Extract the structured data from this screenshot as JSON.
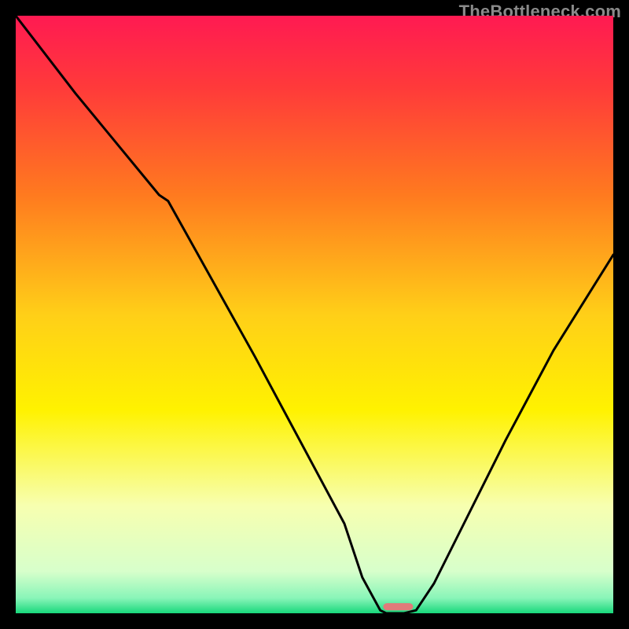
{
  "watermark": "TheBottleneck.com",
  "chart_data": {
    "type": "line",
    "title": "",
    "xlabel": "",
    "ylabel": "",
    "xlim": [
      0,
      100
    ],
    "ylim": [
      0,
      100
    ],
    "grid": false,
    "legend": null,
    "background_gradient": {
      "stops": [
        {
          "t": 0.0,
          "color": "#ff1a52"
        },
        {
          "t": 0.12,
          "color": "#ff3a3a"
        },
        {
          "t": 0.3,
          "color": "#ff7a1f"
        },
        {
          "t": 0.5,
          "color": "#ffcf18"
        },
        {
          "t": 0.66,
          "color": "#fff200"
        },
        {
          "t": 0.82,
          "color": "#f7ffb0"
        },
        {
          "t": 0.93,
          "color": "#d7ffcb"
        },
        {
          "t": 0.975,
          "color": "#88f5b8"
        },
        {
          "t": 1.0,
          "color": "#17d77b"
        }
      ]
    },
    "series": [
      {
        "name": "bottleneck-curve",
        "color": "#000000",
        "x": [
          0,
          10,
          24,
          25.5,
          40,
          55,
          58,
          61,
          62,
          63,
          65,
          67,
          70,
          75,
          82,
          90,
          100
        ],
        "values": [
          100,
          87,
          70,
          69,
          43,
          15,
          6,
          0.5,
          0,
          0,
          0,
          0.5,
          5,
          15,
          29,
          44,
          60
        ]
      }
    ],
    "marker": {
      "name": "optimal-range",
      "color": "#e27a7a",
      "x_start": 61.5,
      "x_end": 66.5,
      "y": 0.5,
      "height": 1.2
    }
  }
}
